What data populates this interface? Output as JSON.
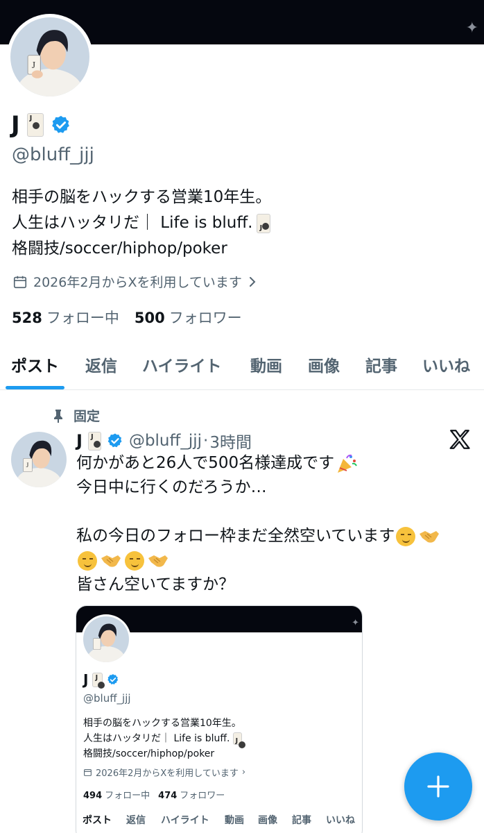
{
  "banner": {
    "sparkle_icon": "sparkle-icon"
  },
  "profile": {
    "name": "J",
    "handle": "@bluff_jjj",
    "bio": {
      "line1": "相手の脳をハックする営業10年生。",
      "line2": "人生はハッタリだ｜ Life is bluff.",
      "line3": "格闘技/soccer/hiphop/poker"
    },
    "joined": "2026年2月からXを利用しています",
    "following_count": "528",
    "following_label": "フォロー中",
    "followers_count": "500",
    "followers_label": "フォロワー"
  },
  "tabs": [
    {
      "label": "ポスト",
      "active": true
    },
    {
      "label": "返信"
    },
    {
      "label": "ハイライト"
    },
    {
      "label": "動画"
    },
    {
      "label": "画像"
    },
    {
      "label": "記事"
    },
    {
      "label": "いいね"
    }
  ],
  "post": {
    "pinned_label": "固定",
    "author_name": "J",
    "author_handle": "@bluff_jjj",
    "separator": "·",
    "time": "3時間",
    "text": {
      "line1": "何かがあと26人で500名様達成です",
      "line2": "今日中に行くのだろうか…",
      "line3": "私の今日のフォロー枠まだ全然空いています",
      "line5": "皆さん空いてますか？"
    },
    "embed": {
      "name": "J",
      "handle": "@bluff_jjj",
      "bio_line1": "相手の脳をハックする営業10年生。",
      "bio_line2": "人生はハッタリだ｜ Life is bluff.",
      "bio_line3": "格闘技/soccer/hiphop/poker",
      "joined": "2026年2月からXを利用しています",
      "following_count": "494",
      "following_label": "フォロー中",
      "followers_count": "474",
      "followers_label": "フォロワー",
      "tabs": [
        "ポスト",
        "返信",
        "ハイライト",
        "動画",
        "画像",
        "記事",
        "いいね"
      ]
    }
  },
  "colors": {
    "accent": "#1d9bf0",
    "text": "#0f1419",
    "muted": "#536471",
    "banner": "#05070f"
  }
}
